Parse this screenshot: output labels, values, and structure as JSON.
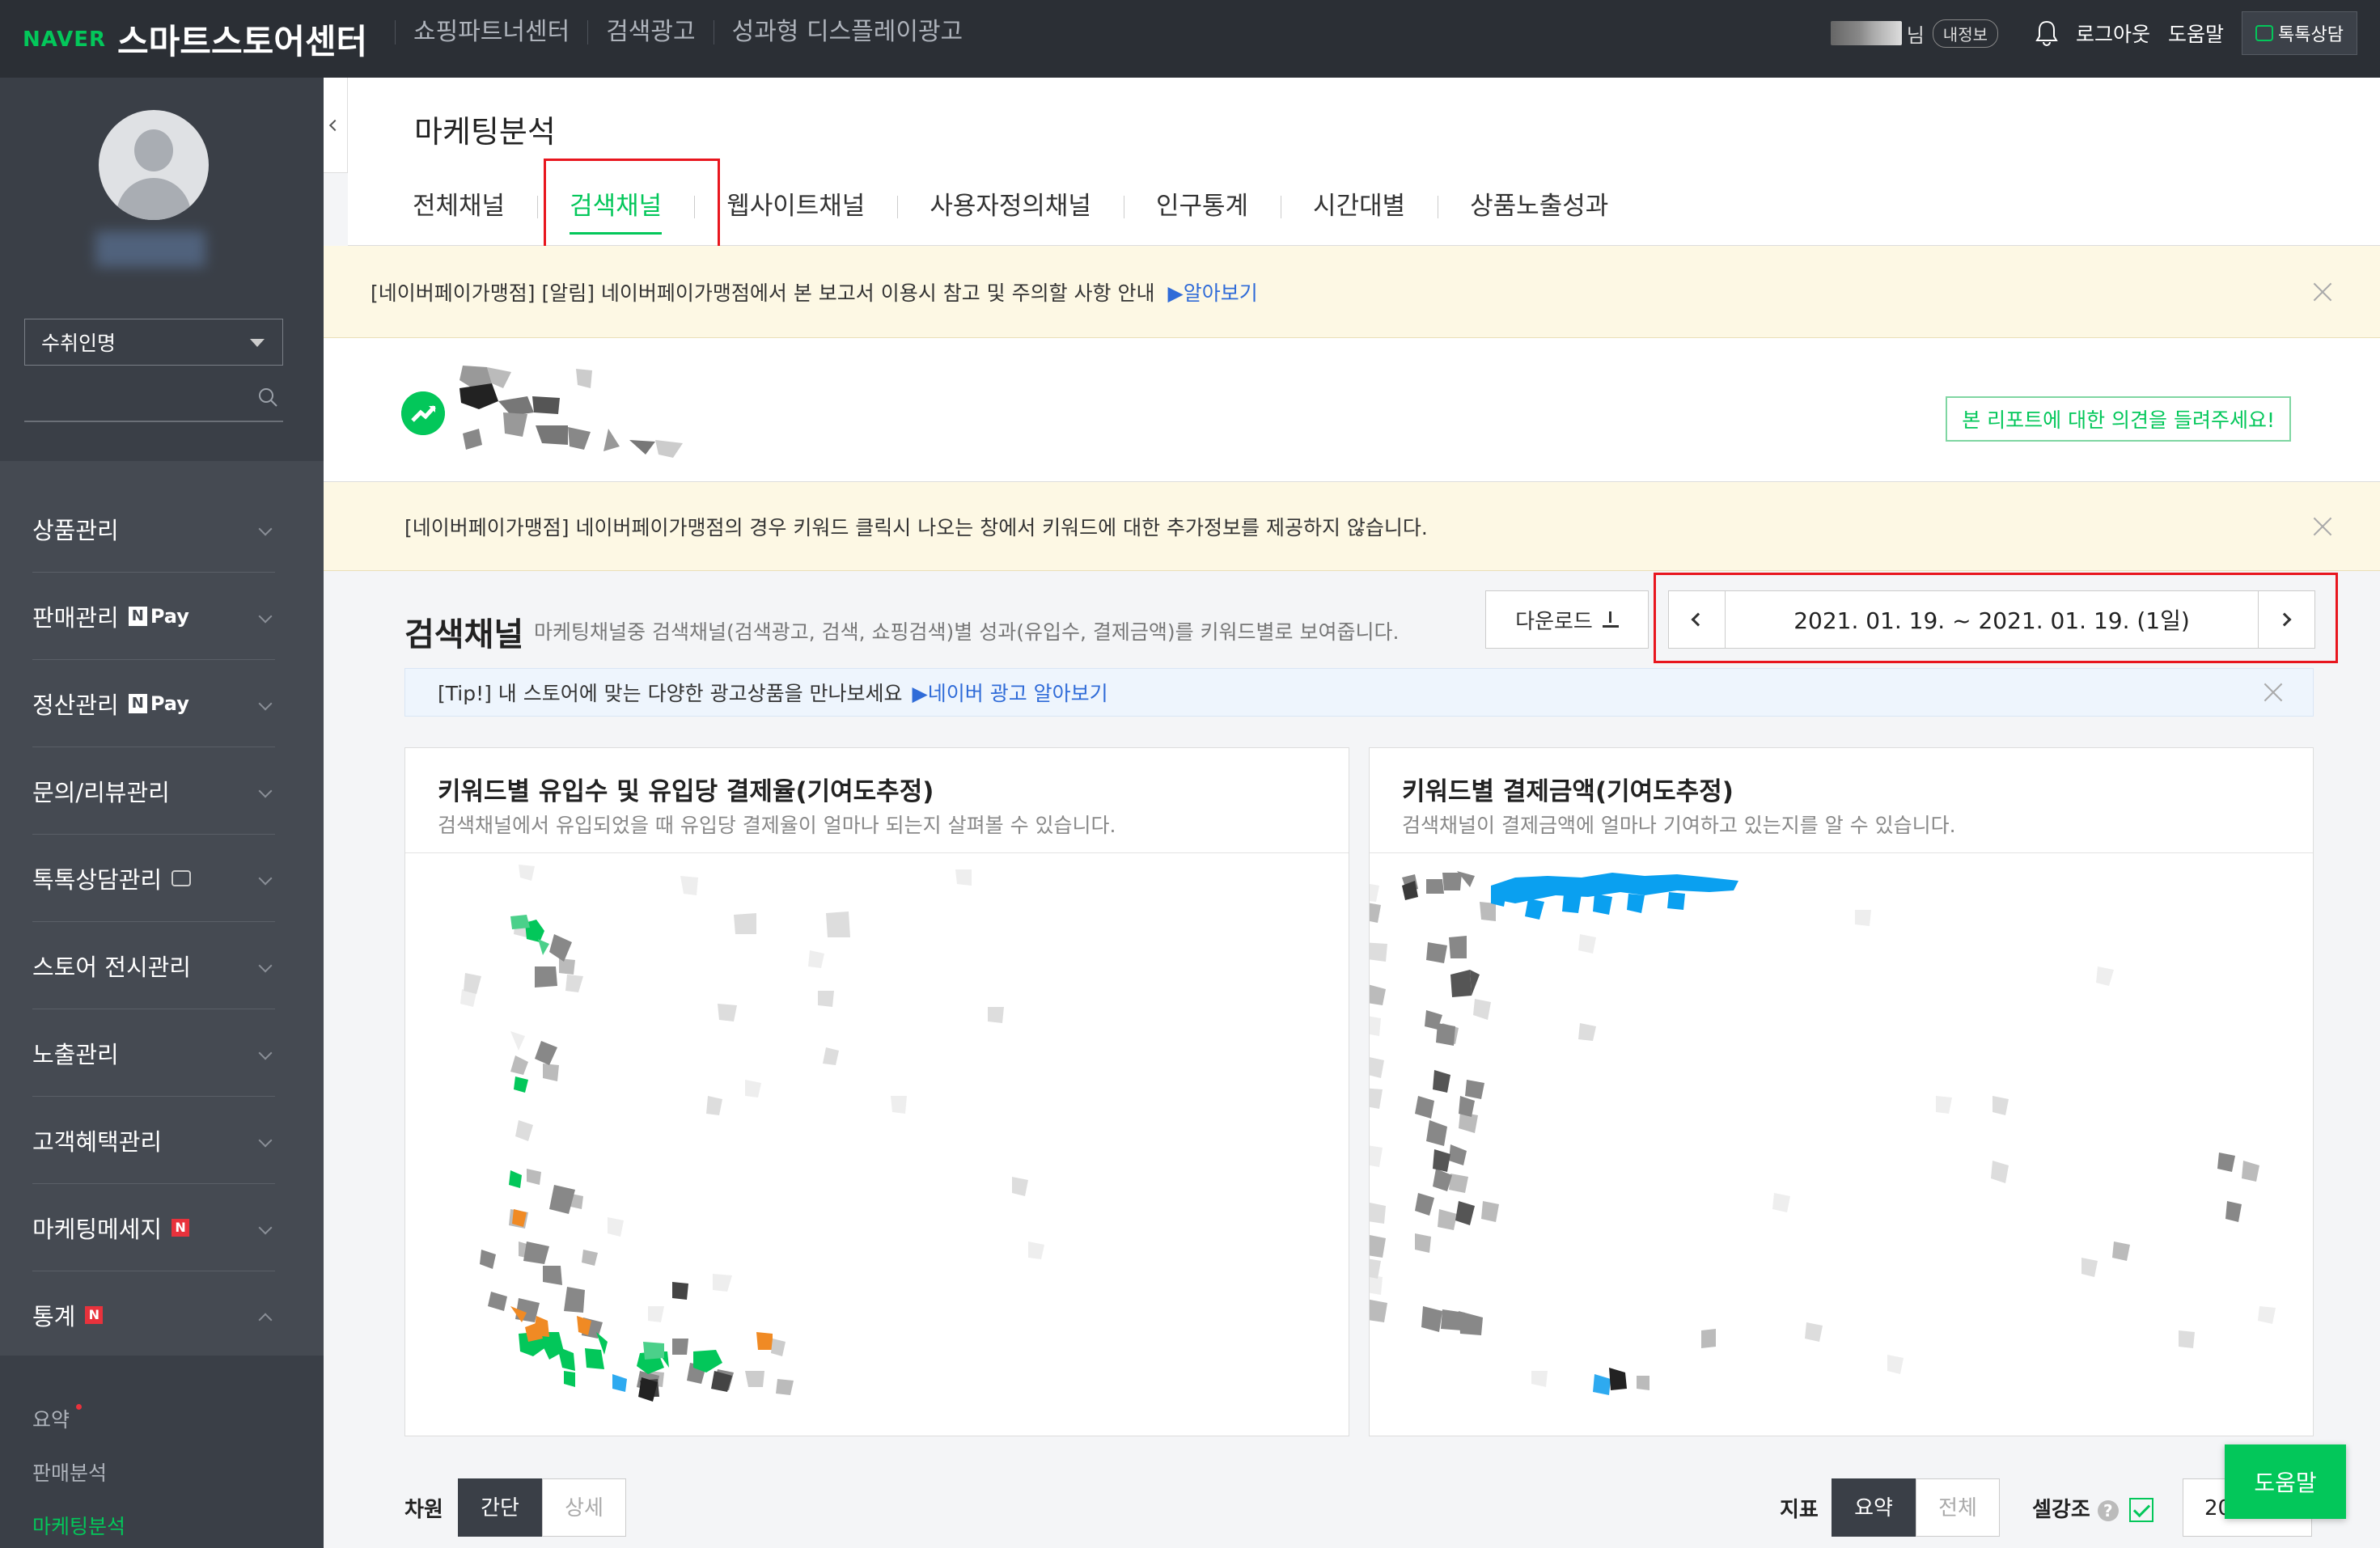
{
  "topbar": {
    "brand": "NAVER",
    "title": "스마트스토어센터",
    "nav": [
      "쇼핑파트너센터",
      "검색광고",
      "성과형 디스플레이광고"
    ],
    "user_suffix": "님",
    "myinfo": "내정보",
    "logout": "로그아웃",
    "help": "도움말",
    "talk": "톡톡상담"
  },
  "sidebar": {
    "select_value": "수취인명",
    "menu": [
      {
        "label": "상품관리"
      },
      {
        "label": "판매관리",
        "badge": "Pay"
      },
      {
        "label": "정산관리",
        "badge": "Pay"
      },
      {
        "label": "문의/리뷰관리"
      },
      {
        "label": "톡톡상담관리"
      },
      {
        "label": "스토어 전시관리"
      },
      {
        "label": "노출관리"
      },
      {
        "label": "고객혜택관리"
      },
      {
        "label": "마케팅메세지",
        "badge": "N"
      },
      {
        "label": "통계",
        "badge": "N"
      }
    ],
    "pay_n": "N",
    "submenu": [
      "요약",
      "판매분석",
      "마케팅분석"
    ]
  },
  "header": {
    "title": "마케팅분석",
    "tabs": [
      "전체채널",
      "검색채널",
      "웹사이트채널",
      "사용자정의채널",
      "인구통계",
      "시간대별",
      "상품노출성과"
    ],
    "active_tab": "검색채널"
  },
  "notice1": {
    "text": "[네이버페이가맹점] [알림] 네이버페이가맹점에서 본 보고서 이용시 참고 및 주의할 사항 안내",
    "link": "▶알아보기"
  },
  "promo": {
    "feedback": "본 리포트에 대한 의견을 들려주세요!"
  },
  "notice2": {
    "text": "[네이버페이가맹점] 네이버페이가맹점의 경우 키워드 클릭시 나오는 창에서 키워드에 대한 추가정보를 제공하지 않습니다."
  },
  "section": {
    "title": "검색채널",
    "desc": "마케팅채널중 검색채널(검색광고, 검색, 쇼핑검색)별 성과(유입수, 결제금액)를 키워드별로 보여줍니다.",
    "download": "다운로드",
    "date_range": "2021. 01. 19. ~ 2021. 01. 19. (1일)"
  },
  "tip": {
    "text": "[Tip!] 내 스토어에 맞는 다양한 광고상품을 만나보세요",
    "link": "▶네이버 광고 알아보기"
  },
  "panels": [
    {
      "title": "키워드별 유입수 및 유입당 결제율(기여도추정)",
      "desc": "검색채널에서 유입되었을 때 유입당 결제율이 얼마나 되는지 살펴볼 수 있습니다."
    },
    {
      "title": "키워드별 결제금액(기여도추정)",
      "desc": "검색채널이 결제금액에 얼마나 기여하고 있는지를 알 수 있습니다."
    }
  ],
  "controls": {
    "dimension_label": "차원",
    "dimension_options": [
      "간단",
      "상세"
    ],
    "metric_label": "지표",
    "metric_options": [
      "요약",
      "전체"
    ],
    "highlight_label": "셀강조",
    "qmark": "?",
    "rows_value": "20"
  },
  "help_button": "도움말",
  "colors": {
    "accent": "#03c75a",
    "highlight_box": "#e8161e",
    "link": "#2f6bd8",
    "bar_blue": "#0aa0f0"
  }
}
